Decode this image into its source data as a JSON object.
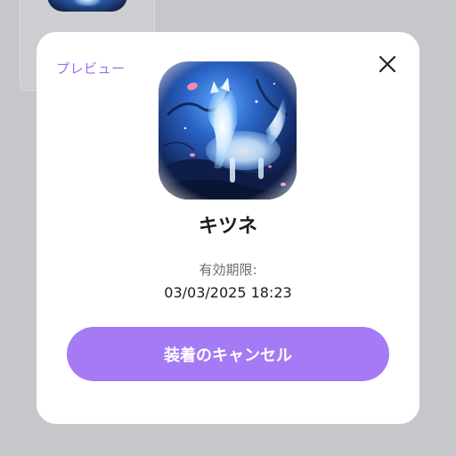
{
  "modal": {
    "preview_label": "プレビュー",
    "close_icon": "close-icon",
    "item_name": "キツネ",
    "item_image": "fox-avatar-image",
    "expiry_label": "有効期限:",
    "expiry_value": "03/03/2025 18:23",
    "cancel_button_label": "装着のキャンセル"
  },
  "colors": {
    "accent": "#a57af5",
    "preview_label": "#9b6cf0",
    "overlay": "#c6c7ca",
    "modal_background": "#ffffff"
  }
}
